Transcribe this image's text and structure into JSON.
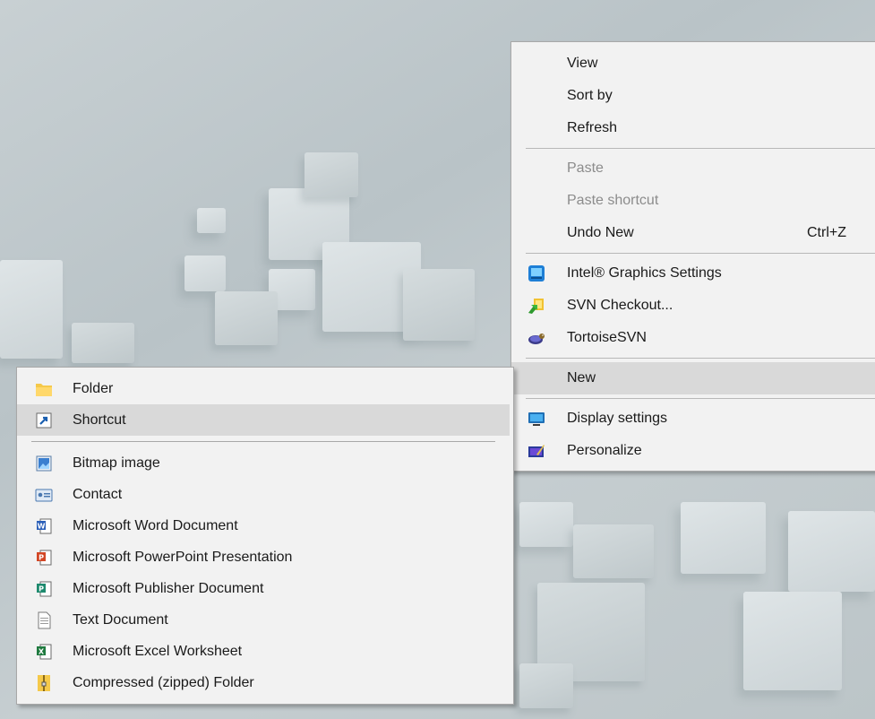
{
  "context_menu": {
    "group1": [
      {
        "label": "View"
      },
      {
        "label": "Sort by"
      },
      {
        "label": "Refresh"
      }
    ],
    "group2": [
      {
        "label": "Paste",
        "disabled": true
      },
      {
        "label": "Paste shortcut",
        "disabled": true
      },
      {
        "label": "Undo New",
        "shortcut": "Ctrl+Z"
      }
    ],
    "group3": [
      {
        "label": "Intel® Graphics Settings",
        "icon": "intel-graphics-icon"
      },
      {
        "label": "SVN Checkout...",
        "icon": "svn-checkout-icon"
      },
      {
        "label": "TortoiseSVN",
        "icon": "tortoisesvn-icon"
      }
    ],
    "group4": [
      {
        "label": "New",
        "highlighted": true
      }
    ],
    "group5": [
      {
        "label": "Display settings",
        "icon": "display-icon"
      },
      {
        "label": "Personalize",
        "icon": "personalize-icon"
      }
    ]
  },
  "new_submenu": {
    "top": [
      {
        "label": "Folder",
        "icon": "folder-icon"
      },
      {
        "label": "Shortcut",
        "icon": "shortcut-icon",
        "highlighted": true
      }
    ],
    "items": [
      {
        "label": "Bitmap image",
        "icon": "bitmap-icon"
      },
      {
        "label": "Contact",
        "icon": "contact-icon"
      },
      {
        "label": "Microsoft Word Document",
        "icon": "word-icon"
      },
      {
        "label": "Microsoft PowerPoint Presentation",
        "icon": "powerpoint-icon"
      },
      {
        "label": "Microsoft Publisher Document",
        "icon": "publisher-icon"
      },
      {
        "label": "Text Document",
        "icon": "text-document-icon"
      },
      {
        "label": "Microsoft Excel Worksheet",
        "icon": "excel-icon"
      },
      {
        "label": "Compressed (zipped) Folder",
        "icon": "zip-folder-icon"
      }
    ]
  },
  "colors": {
    "menu_bg": "#f2f2f2",
    "highlight": "#d9d9d9",
    "disabled_text": "#8c8c8c"
  }
}
